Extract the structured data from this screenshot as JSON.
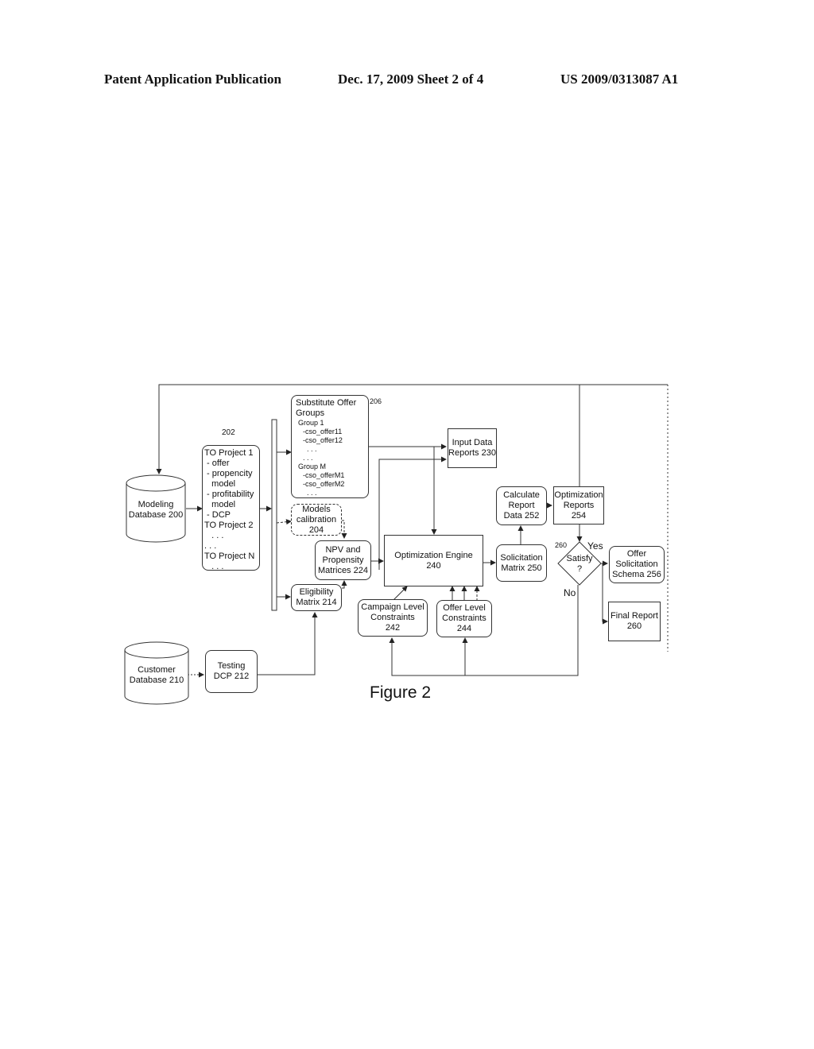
{
  "header": {
    "publication": "Patent Application Publication",
    "date_sheet": "Dec. 17, 2009   Sheet 2 of 4",
    "patent_number": "US 2009/0313087 A1"
  },
  "figure_caption": "Figure 2",
  "nodes": {
    "modeling_db": {
      "lines": [
        "Modeling",
        "Database 200"
      ]
    },
    "customer_db": {
      "lines": [
        "Customer",
        "Database 210"
      ]
    },
    "to_projects": {
      "ref": "202",
      "lines": [
        "TO Project 1",
        " - offer",
        " - propencity",
        "   model",
        " - profitability",
        "   model",
        " - DCP",
        "TO Project 2",
        "   . . .",
        ". . .",
        "TO Project N",
        "   . . ."
      ]
    },
    "substitute_offer": {
      "ref": "206",
      "lines": [
        "Substitute Offer",
        "Groups",
        "Group 1",
        "-cso_offer11",
        "-cso_offer12",
        ". . .",
        ". . .",
        "Group M",
        "-cso_offerM1",
        "-cso_offerM2",
        ". . ."
      ]
    },
    "models_calibration": {
      "lines": [
        "Models",
        "calibration",
        "204"
      ]
    },
    "npv_matrices": {
      "lines": [
        "NPV and",
        "Propensity",
        "Matrices 224"
      ]
    },
    "eligibility_matrix": {
      "lines": [
        "Eligibility",
        "Matrix 214"
      ]
    },
    "testing_dcp": {
      "lines": [
        "Testing",
        "DCP 212"
      ]
    },
    "input_data_reports": {
      "lines": [
        "Input Data",
        "Reports 230"
      ]
    },
    "optimization_engine": {
      "lines": [
        "Optimization Engine",
        "240"
      ]
    },
    "campaign_constraints": {
      "lines": [
        "Campaign Level",
        "Constraints",
        "242"
      ]
    },
    "offer_constraints": {
      "lines": [
        "Offer Level",
        "Constraints",
        "244"
      ]
    },
    "solicitation_matrix": {
      "lines": [
        "Solicitation",
        "Matrix 250"
      ]
    },
    "calculate_report": {
      "lines": [
        "Calculate",
        "Report",
        "Data 252"
      ]
    },
    "optimization_reports": {
      "lines": [
        "Optimization",
        "Reports",
        "254"
      ]
    },
    "satisfy": {
      "ref": "260",
      "lines": [
        "Satisfy",
        "?"
      ],
      "yes": "Yes",
      "no": "No"
    },
    "offer_schema": {
      "lines": [
        "Offer",
        "Solicitation",
        "Schema 256"
      ]
    },
    "final_report": {
      "lines": [
        "Final Report",
        "260"
      ]
    }
  }
}
